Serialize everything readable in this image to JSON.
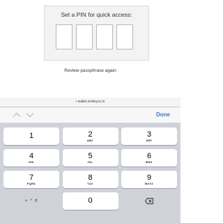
{
  "pin": {
    "prompt": "Set a PIN for quick access:",
    "boxes": [
      "",
      "",
      "",
      ""
    ]
  },
  "review_link": "Review passphrase again",
  "keyboard": {
    "url": "• wallet.smileyco.in",
    "done_label": "Done",
    "keys": [
      {
        "digit": "1",
        "letters": ""
      },
      {
        "digit": "2",
        "letters": "ABC"
      },
      {
        "digit": "3",
        "letters": "DEF"
      },
      {
        "digit": "4",
        "letters": "GHI"
      },
      {
        "digit": "5",
        "letters": "JKL"
      },
      {
        "digit": "6",
        "letters": "MNO"
      },
      {
        "digit": "7",
        "letters": "PQRS"
      },
      {
        "digit": "8",
        "letters": "TUV"
      },
      {
        "digit": "9",
        "letters": "WXYZ"
      },
      {
        "symbols": "+ * #"
      },
      {
        "digit": "0"
      },
      {
        "icon": "backspace-icon"
      }
    ]
  },
  "colors": {
    "accent": "#3b79c7",
    "keyboard_bg": "#cfd3d9"
  }
}
